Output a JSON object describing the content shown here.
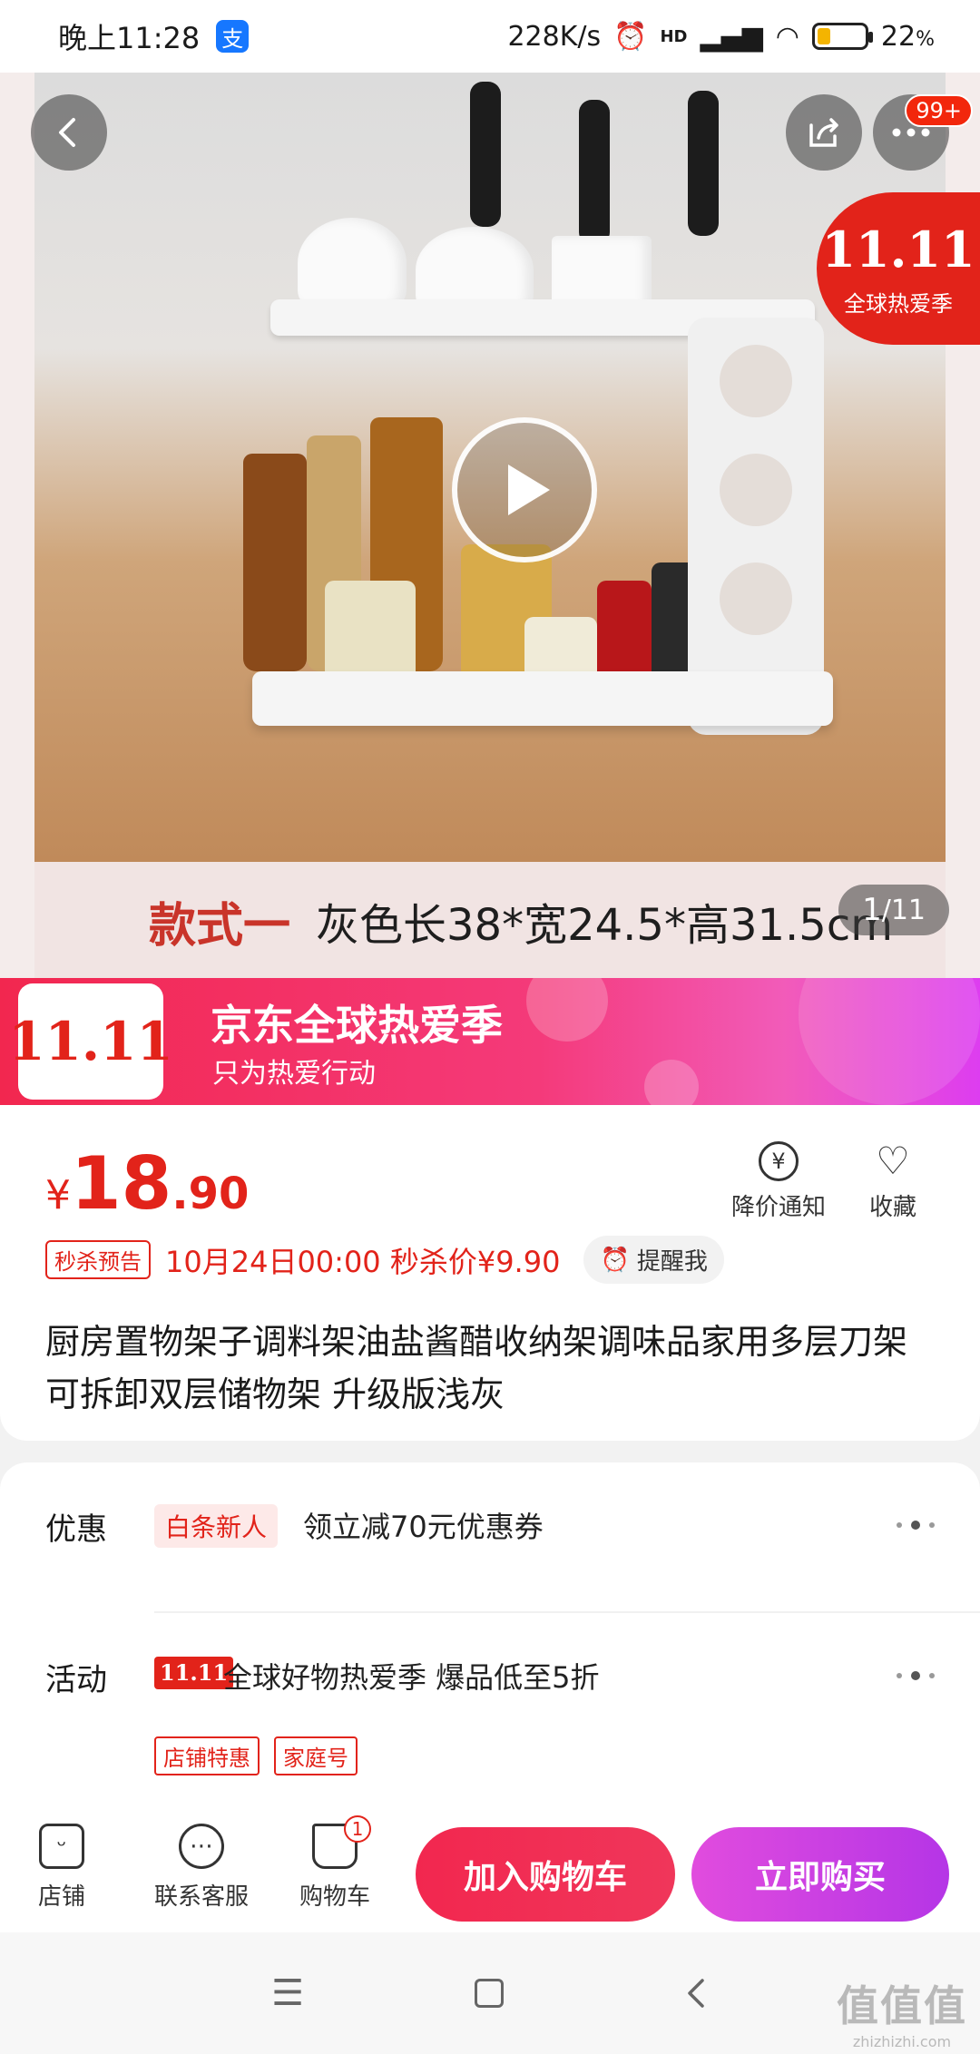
{
  "status_bar": {
    "time": "晚上11:28",
    "app_badge": "支",
    "net_speed": "228K/s",
    "signal": "HD",
    "battery": "22",
    "battery_unit": "%"
  },
  "hero": {
    "caption_red": "款式一",
    "caption_text": "灰色长38*宽24.5*高31.5cm",
    "counter_current": "1",
    "counter_total": "/11",
    "more_badge": "99+",
    "corner_logo": "11.11",
    "corner_text": "全球热爱季"
  },
  "banner": {
    "logo": "11.11",
    "title": "京东全球热爱季",
    "subtitle": "只为热爱行动"
  },
  "product": {
    "currency": "¥",
    "price_int": "18",
    "price_dec": ".90",
    "price_alert_label": "降价通知",
    "favorite_label": "收藏",
    "seckill_tag": "秒杀预告",
    "seckill_info": "10月24日00:00 秒杀价¥9.90",
    "remind_label": "提醒我",
    "title": "厨房置物架子调料架油盐酱醋收纳架调味品家用多层刀架可拆卸双层储物架 升级版浅灰"
  },
  "promo": {
    "discount_label": "优惠",
    "discount_pill": "白条新人",
    "discount_text": "领立减70元优惠券",
    "activity_label": "活动",
    "activity_logo": "11.11",
    "activity_text": "全球好物热爱季 爆品低至5折",
    "activity_tags": [
      "店铺特惠",
      "家庭号"
    ]
  },
  "bottom_bar": {
    "store": "店铺",
    "service": "联系客服",
    "cart": "购物车",
    "cart_count": "1",
    "add_to_cart": "加入购物车",
    "buy_now": "立即购买"
  },
  "watermark": {
    "big": "值值值",
    "small": "zhizhizhi.com"
  },
  "colors": {
    "jd_red": "#e2231a",
    "buy_purple": "#b535e6"
  }
}
